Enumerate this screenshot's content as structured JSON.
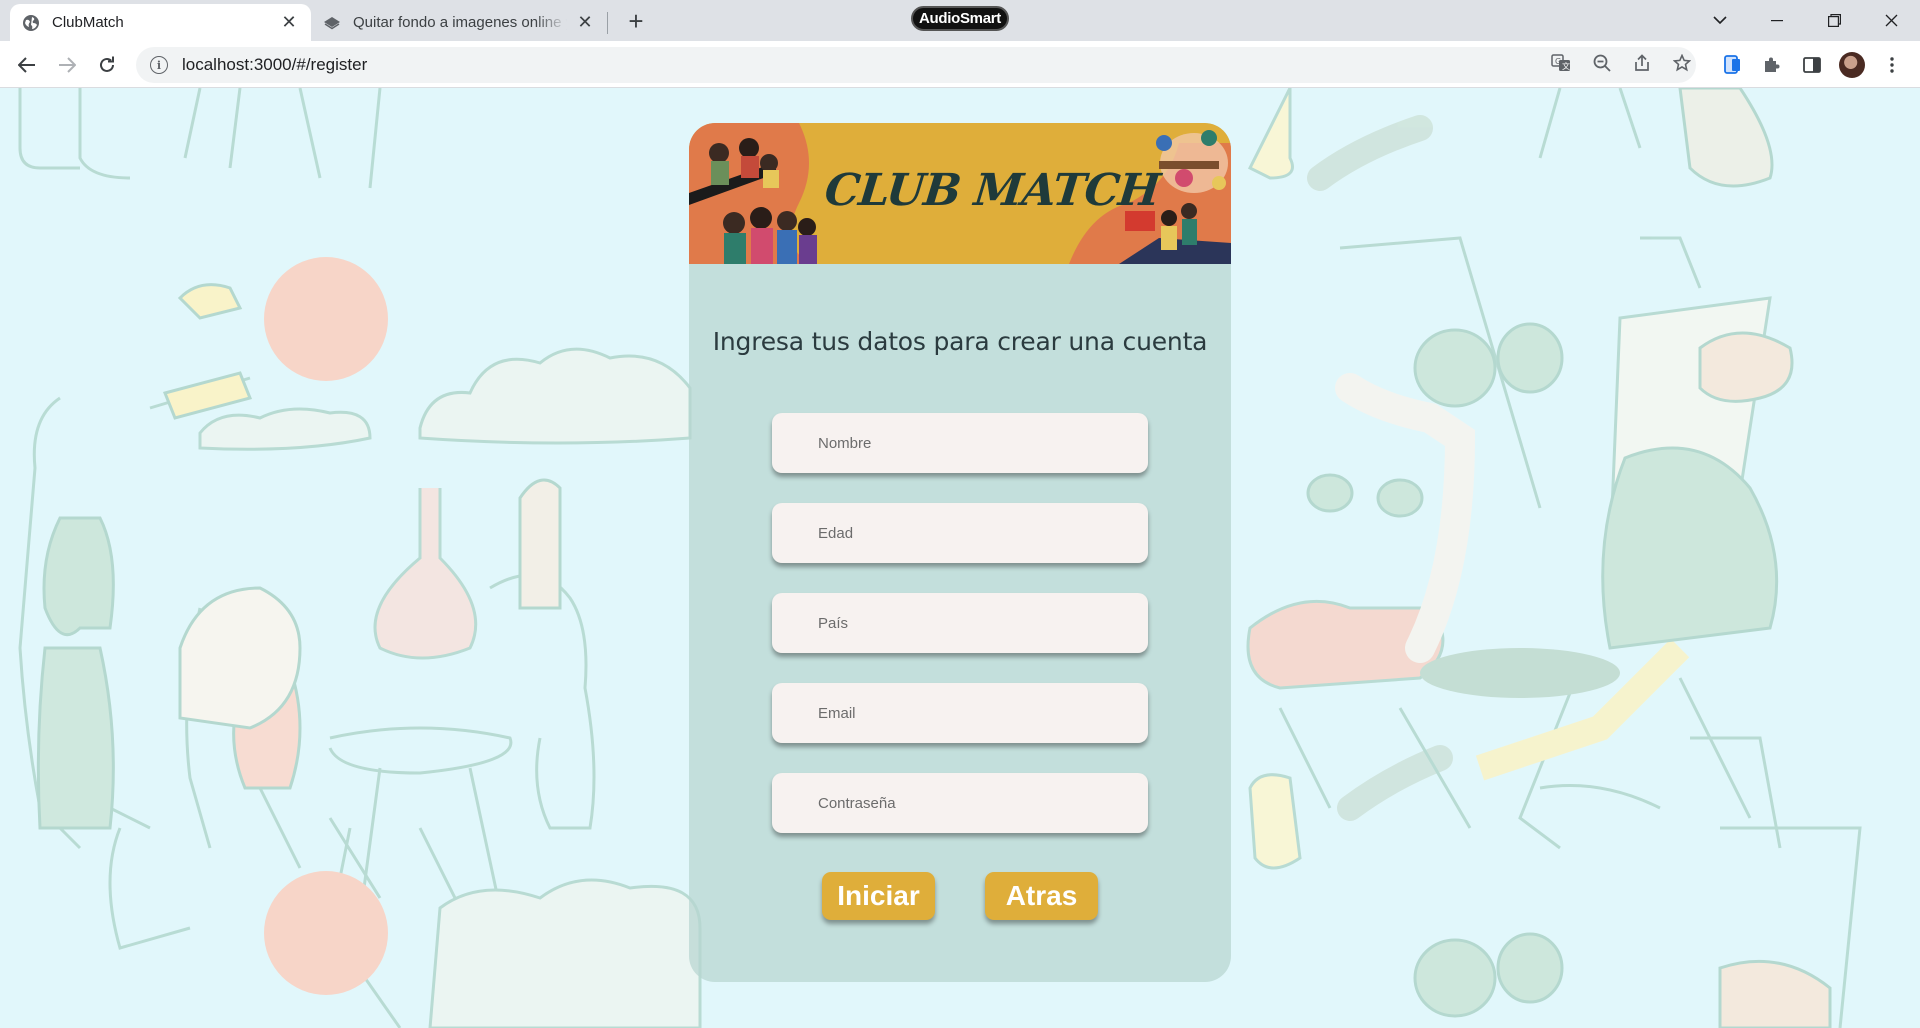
{
  "browser": {
    "tabs": [
      {
        "title": "ClubMatch",
        "active": true
      },
      {
        "title": "Quitar fondo a imagenes online y gratis",
        "active": false
      }
    ],
    "extension_badge": "AudioSmart",
    "url": "localhost:3000/#/register"
  },
  "colors": {
    "background": "#e1f7fb",
    "card": "#b7d6d0",
    "accent": "#dfae3a",
    "field": "#f7f2f0"
  },
  "banner": {
    "title": "CLUB MATCH"
  },
  "form": {
    "heading": "Ingresa tus datos para crear una cuenta",
    "fields": [
      {
        "placeholder": "Nombre",
        "value": ""
      },
      {
        "placeholder": "Edad",
        "value": ""
      },
      {
        "placeholder": "País",
        "value": ""
      },
      {
        "placeholder": "Email",
        "value": ""
      },
      {
        "placeholder": "Contraseña",
        "value": ""
      }
    ],
    "submit_label": "Iniciar",
    "back_label": "Atras"
  }
}
